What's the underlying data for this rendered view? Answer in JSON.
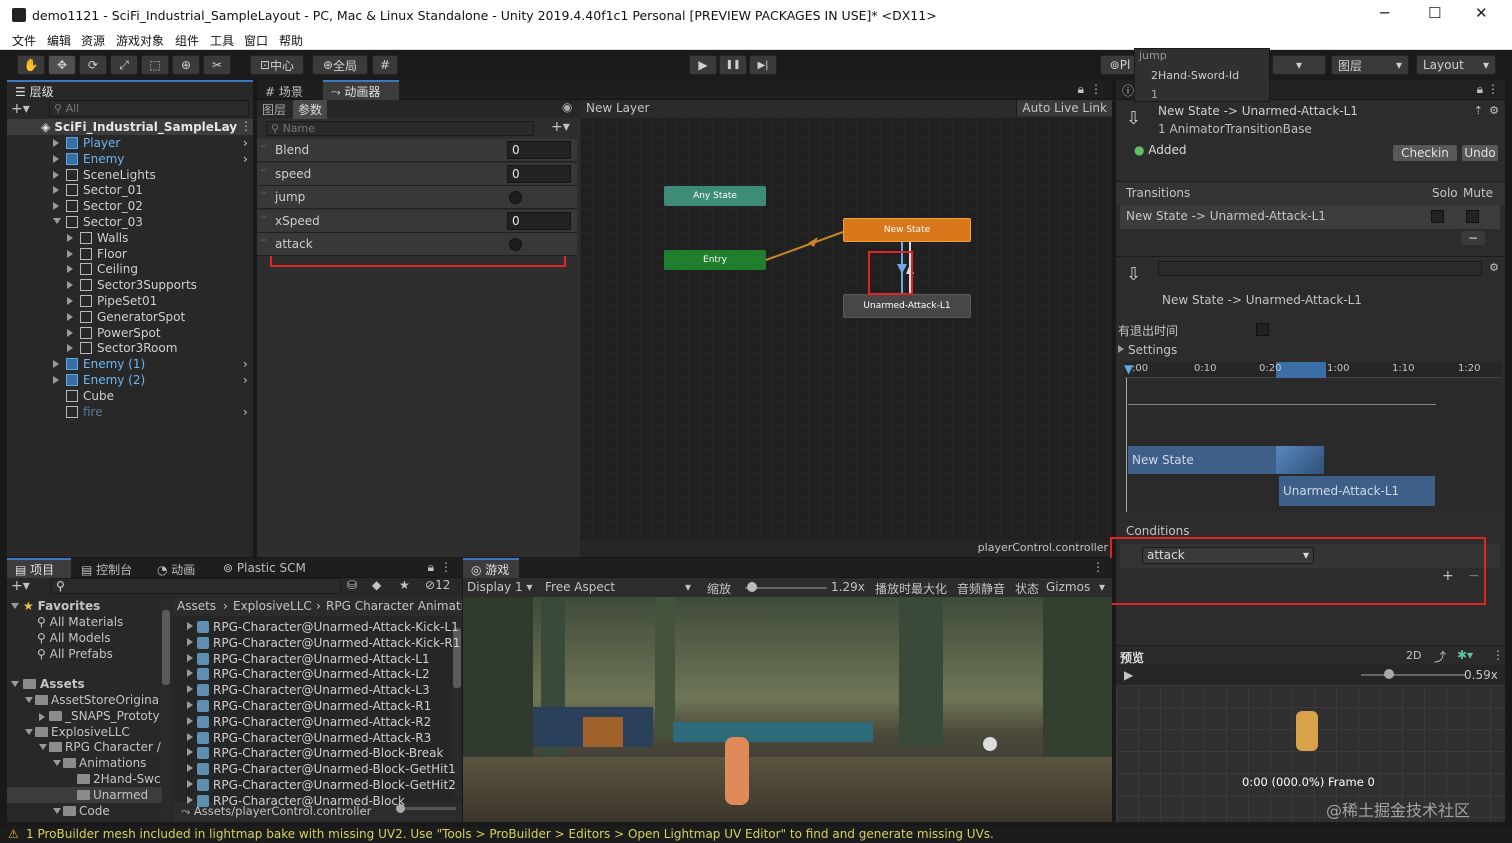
{
  "window": {
    "title": "demo1121 - SciFi_Industrial_SampleLayout - PC, Mac & Linux Standalone - Unity 2019.4.40f1c1 Personal [PREVIEW PACKAGES IN USE]* <DX11>",
    "minimize": "─",
    "maximize": "☐",
    "close": "✕"
  },
  "menu": [
    "文件",
    "编辑",
    "资源",
    "游戏对象",
    "组件",
    "工具",
    "窗口",
    "帮助"
  ],
  "toolbar": {
    "pivot": "中心",
    "global": "全局",
    "play": "▶",
    "pause": "❚❚",
    "step": "▶|",
    "plastic": "Pl",
    "layers": "图层",
    "layout": "Layout"
  },
  "hierarchy": {
    "tab": "层级",
    "search_placeholder": "All",
    "scene": "SciFi_Industrial_SampleLay",
    "items": [
      {
        "label": "Player",
        "indent": 1,
        "blue": true,
        "arrow": "r",
        "more": true
      },
      {
        "label": "Enemy",
        "indent": 1,
        "blue": true,
        "arrow": "r",
        "more": true
      },
      {
        "label": "SceneLights",
        "indent": 1,
        "arrow": "r"
      },
      {
        "label": "Sector_01",
        "indent": 1,
        "arrow": "r"
      },
      {
        "label": "Sector_02",
        "indent": 1,
        "arrow": "r"
      },
      {
        "label": "Sector_03",
        "indent": 1,
        "arrow": "d"
      },
      {
        "label": "Walls",
        "indent": 2,
        "arrow": "r"
      },
      {
        "label": "Floor",
        "indent": 2,
        "arrow": "r"
      },
      {
        "label": "Ceiling",
        "indent": 2,
        "arrow": "r"
      },
      {
        "label": "Sector3Supports",
        "indent": 2,
        "arrow": "r"
      },
      {
        "label": "PipeSet01",
        "indent": 2,
        "arrow": "r"
      },
      {
        "label": "GeneratorSpot",
        "indent": 2,
        "arrow": "r"
      },
      {
        "label": "PowerSpot",
        "indent": 2,
        "arrow": "r"
      },
      {
        "label": "Sector3Room",
        "indent": 2,
        "arrow": "r"
      },
      {
        "label": "Enemy (1)",
        "indent": 1,
        "blue": true,
        "arrow": "r",
        "more": true
      },
      {
        "label": "Enemy (2)",
        "indent": 1,
        "blue": true,
        "arrow": "r",
        "more": true
      },
      {
        "label": "Cube",
        "indent": 1
      },
      {
        "label": "fire",
        "indent": 1,
        "faded": true,
        "more": true
      }
    ]
  },
  "animator": {
    "tab_scene": "场景",
    "tab_animator": "动画器",
    "sub_layers": "图层",
    "sub_params": "参数",
    "name_placeholder": "Name",
    "breadcrumb": "New Layer",
    "auto_live": "Auto Live Link",
    "params": [
      {
        "name": "Blend",
        "value": "0",
        "type": "float"
      },
      {
        "name": "speed",
        "value": "0",
        "type": "float"
      },
      {
        "name": "jump",
        "type": "bool"
      },
      {
        "name": "xSpeed",
        "value": "0",
        "type": "float"
      },
      {
        "name": "attack",
        "type": "trigger"
      }
    ],
    "nodes": {
      "any": "Any State",
      "entry": "Entry",
      "new": "New State",
      "unarmed": "Unarmed-Attack-L1"
    },
    "footer": "playerControl.controller"
  },
  "inspector": {
    "popup_items": [
      "jump",
      "2Hand-Sword-Id",
      "1"
    ],
    "transition_title": "New State -> Unarmed-Attack-L1",
    "transition_sub": "1 AnimatorTransitionBase",
    "added": "Added",
    "checkin": "Checkin",
    "undo": "Undo",
    "transitions_header": "Transitions",
    "solo": "Solo",
    "mute": "Mute",
    "transition_row": "New State -> Unarmed-Attack-L1",
    "transition_name": "New State -> Unarmed-Attack-L1",
    "has_exit": "有退出时间",
    "settings": "Settings",
    "timeline_ticks": [
      ":00",
      "0:10",
      "0:20",
      "1:00",
      "1:10",
      "1:20"
    ],
    "tl_new_state": "New State",
    "tl_unarmed": "Unarmed-Attack-L1",
    "conditions": "Conditions",
    "condition_value": "attack",
    "preview": "预览",
    "preview_2d": "2D",
    "preview_speed": "0.59x",
    "preview_frame": "0:00 (000.0%) Frame 0"
  },
  "project": {
    "tabs": [
      "项目",
      "控制台",
      "动画",
      "Plastic SCM"
    ],
    "hidden_count": "12",
    "favorites": "Favorites",
    "fav_items": [
      "All Materials",
      "All Models",
      "All Prefabs"
    ],
    "assets": "Assets",
    "tree": [
      {
        "label": "AssetStoreOrigina",
        "indent": 1
      },
      {
        "label": "_SNAPS_Prototy",
        "indent": 2
      },
      {
        "label": "ExplosiveLLC",
        "indent": 1
      },
      {
        "label": "RPG Character /",
        "indent": 2
      },
      {
        "label": "Animations",
        "indent": 3
      },
      {
        "label": "2Hand-Swc",
        "indent": 4
      },
      {
        "label": "Unarmed",
        "indent": 4,
        "selected": true
      },
      {
        "label": "Code",
        "indent": 3
      }
    ],
    "breadcrumb": [
      "Assets",
      "ExplosiveLLC",
      "RPG Character Animatic"
    ],
    "files": [
      "RPG-Character@Unarmed-Attack-Kick-L1",
      "RPG-Character@Unarmed-Attack-Kick-R1",
      "RPG-Character@Unarmed-Attack-L1",
      "RPG-Character@Unarmed-Attack-L2",
      "RPG-Character@Unarmed-Attack-L3",
      "RPG-Character@Unarmed-Attack-R1",
      "RPG-Character@Unarmed-Attack-R2",
      "RPG-Character@Unarmed-Attack-R3",
      "RPG-Character@Unarmed-Block-Break",
      "RPG-Character@Unarmed-Block-GetHit1",
      "RPG-Character@Unarmed-Block-GetHit2",
      "RPG-Character@Unarmed-Block"
    ],
    "footer_path": "Assets/playerControl.controller"
  },
  "game": {
    "tab": "游戏",
    "display": "Display 1",
    "aspect": "Free Aspect",
    "scale_label": "缩放",
    "scale": "1.29x",
    "maximize": "播放时最大化",
    "mute": "音频静音",
    "stats": "状态",
    "gizmos": "Gizmos"
  },
  "status": "1 ProBuilder mesh included in lightmap bake with missing UV2. Use \"Tools > ProBuilder > Editors > Open Lightmap UV Editor\" to find and generate missing UVs.",
  "watermark": "@稀土掘金技术社区"
}
